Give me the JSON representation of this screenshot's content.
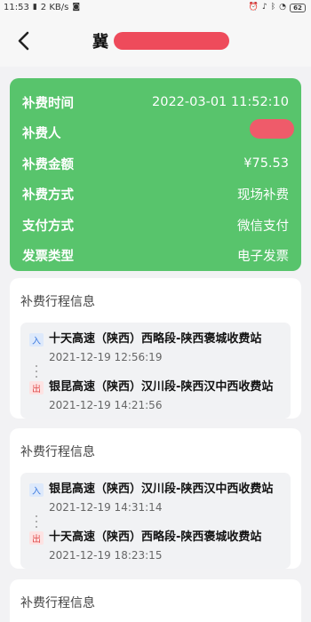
{
  "status_bar": {
    "time": "11:53",
    "signal": "2 KB/s",
    "battery": "62"
  },
  "navbar": {
    "title_visible": "冀"
  },
  "summary": {
    "rows": [
      {
        "label": "补费时间",
        "value": "2022-03-01 11:52:10"
      },
      {
        "label": "补费人",
        "value": "¥"
      },
      {
        "label": "补费金额",
        "value": "¥75.53"
      },
      {
        "label": "补费方式",
        "value": "现场补费"
      },
      {
        "label": "支付方式",
        "value": "微信支付"
      },
      {
        "label": "发票类型",
        "value": "电子发票"
      }
    ]
  },
  "trips": [
    {
      "title": "补费行程信息",
      "entry": {
        "tag": "入",
        "name": "十天高速（陕西）西略段-陕西褒城收费站",
        "time": "2021-12-19 12:56:19"
      },
      "exit": {
        "tag": "出",
        "name": "银昆高速（陕西）汉川段-陕西汉中西收费站",
        "time": "2021-12-19 14:21:56"
      }
    },
    {
      "title": "补费行程信息",
      "entry": {
        "tag": "入",
        "name": "银昆高速（陕西）汉川段-陕西汉中西收费站",
        "time": "2021-12-19 14:31:14"
      },
      "exit": {
        "tag": "出",
        "name": "十天高速（陕西）西略段-陕西褒城收费站",
        "time": "2021-12-19 18:23:15"
      }
    },
    {
      "title": "补费行程信息"
    }
  ]
}
